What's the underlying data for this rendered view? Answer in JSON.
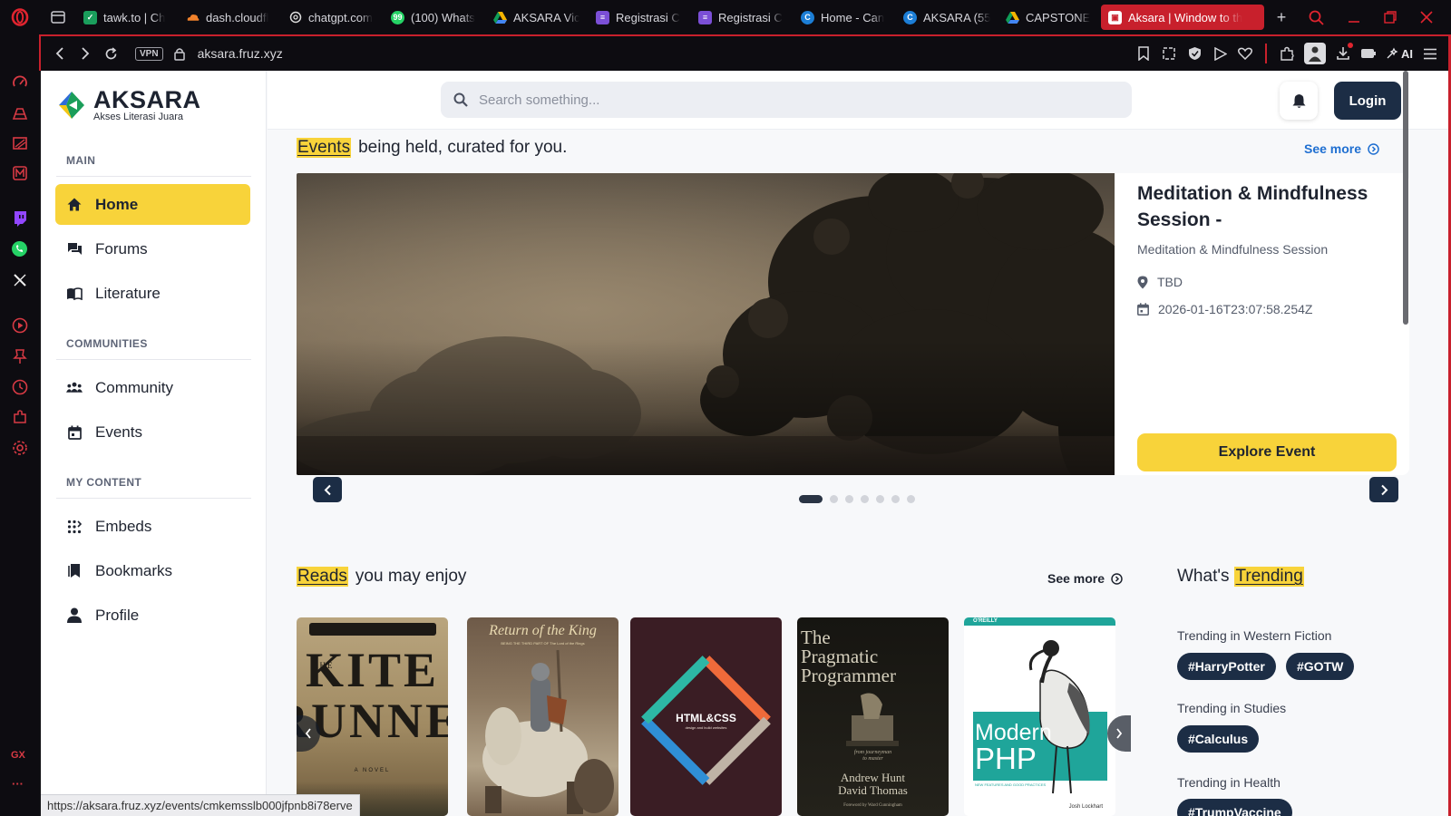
{
  "browser": {
    "tabs": [
      {
        "title": "tawk.to | Ch",
        "color": "#1a9e5c"
      },
      {
        "title": "dash.cloudfl",
        "color": "#f0812b"
      },
      {
        "title": "chatgpt.com",
        "color": "#9aa0a6"
      },
      {
        "title": "(100) Whats",
        "color": "#25d366"
      },
      {
        "title": "AKSARA Vic",
        "color": "#f4b400"
      },
      {
        "title": "Registrasi C",
        "color": "#7b4fd6"
      },
      {
        "title": "Registrasi C",
        "color": "#7b4fd6"
      },
      {
        "title": "Home - Can",
        "color": "#1c7ed6"
      },
      {
        "title": "AKSARA (55",
        "color": "#1c7ed6"
      },
      {
        "title": "CAPSTONE",
        "color": "#f4b400"
      }
    ],
    "active_tab": "Aksara | Window to th",
    "new_tab": "+",
    "vpn": "VPN",
    "url": "aksara.fruz.xyz",
    "ai_label": "AI",
    "gx_label": "GX",
    "more_label": "···",
    "status_url": "https://aksara.fruz.xyz/events/cmkemsslb000jfpnb8i78erve"
  },
  "app": {
    "brand": {
      "name": "AKSARA",
      "tagline": "Akses Literasi Juara"
    },
    "sections": {
      "main": "MAIN",
      "communities": "COMMUNITIES",
      "my_content": "MY CONTENT"
    },
    "nav": {
      "home": "Home",
      "forums": "Forums",
      "literature": "Literature",
      "community": "Community",
      "events": "Events",
      "embeds": "Embeds",
      "bookmarks": "Bookmarks",
      "profile": "Profile"
    },
    "search_placeholder": "Search something...",
    "login": "Login"
  },
  "events": {
    "highlight": "Events",
    "heading_rest": "being held, curated for you.",
    "see_more": "See more",
    "card": {
      "title": "Meditation & Mindfulness Session -",
      "subtitle": "Meditation & Mindfulness Session",
      "location": "TBD",
      "datetime": "2026-01-16T23:07:58.254Z",
      "button": "Explore Event"
    },
    "carousel": {
      "total": 7,
      "active": 0
    }
  },
  "reads": {
    "highlight": "Reads",
    "heading_rest": "you may enjoy",
    "see_more": "See more",
    "books": [
      {
        "title_lines": [
          "KITE",
          "RUNNER"
        ],
        "prefix": "THE",
        "footer": "A NOVEL"
      },
      {
        "title": "Return of the King",
        "subtitle": "BEING THE THIRD PART OF The Lord of the Rings"
      },
      {
        "title": "HTML&CSS",
        "subtitle": "design and build websites"
      },
      {
        "title_lines": [
          "The",
          "Pragmatic",
          "Programmer"
        ],
        "subtitle_lines": [
          "from journeyman",
          "to master"
        ],
        "authors": [
          "Andrew Hunt",
          "David Thomas"
        ],
        "foreword": "Foreword by Ward Cunningham"
      },
      {
        "publisher": "O'REILLY",
        "title_lines": [
          "Modern",
          "PHP"
        ],
        "subtitle": "NEW FEATURES AND GOOD PRACTICES",
        "author": "Josh Lockhart"
      }
    ]
  },
  "trending": {
    "prefix": "What's",
    "highlight": "Trending",
    "groups": [
      {
        "label": "Trending in Western Fiction",
        "tags": [
          "#HarryPotter",
          "#GOTW"
        ]
      },
      {
        "label": "Trending in Studies",
        "tags": [
          "#Calculus"
        ]
      },
      {
        "label": "Trending in Health",
        "tags": [
          "#TrumpVaccine"
        ]
      }
    ]
  },
  "colors": {
    "accent": "#f8d33a",
    "navy": "#1c2d45",
    "browser_red": "#c8202c",
    "link": "#1f6fd1"
  }
}
